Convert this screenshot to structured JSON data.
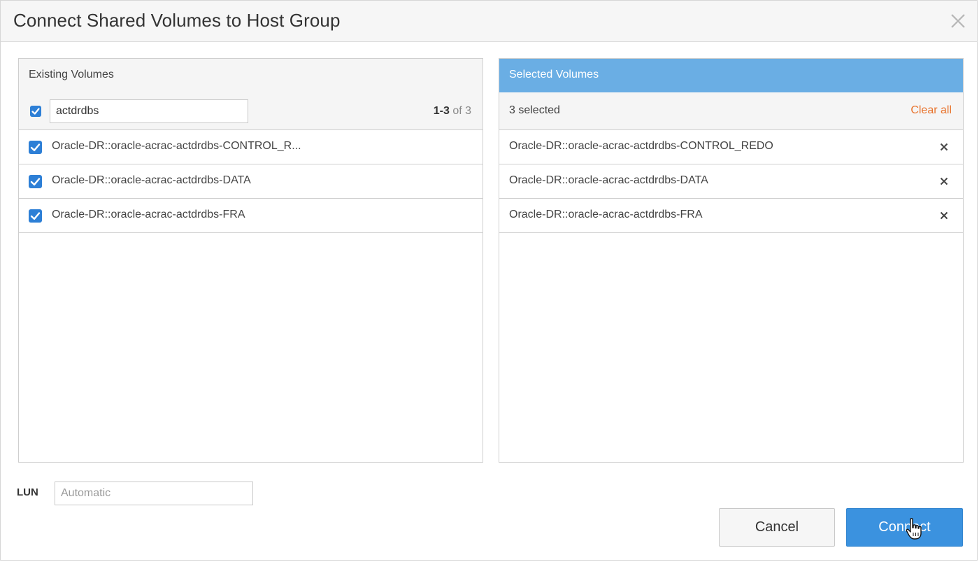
{
  "dialog": {
    "title": "Connect Shared Volumes to Host Group"
  },
  "existing": {
    "title": "Existing Volumes",
    "search_value": "actdrdbs",
    "count_range": "1-3",
    "count_total": "of 3",
    "items": [
      {
        "label": "Oracle-DR::oracle-acrac-actdrdbs-CONTROL_R...",
        "checked": true
      },
      {
        "label": "Oracle-DR::oracle-acrac-actdrdbs-DATA",
        "checked": true
      },
      {
        "label": "Oracle-DR::oracle-acrac-actdrdbs-FRA",
        "checked": true
      }
    ]
  },
  "selected": {
    "title": "Selected Volumes",
    "count_text": "3 selected",
    "clear_all": "Clear all",
    "items": [
      {
        "label": "Oracle-DR::oracle-acrac-actdrdbs-CONTROL_REDO"
      },
      {
        "label": "Oracle-DR::oracle-acrac-actdrdbs-DATA"
      },
      {
        "label": "Oracle-DR::oracle-acrac-actdrdbs-FRA"
      }
    ]
  },
  "lun": {
    "label": "LUN",
    "placeholder": "Automatic"
  },
  "buttons": {
    "cancel": "Cancel",
    "connect": "Connect"
  },
  "colors": {
    "accent": "#3b92df",
    "selected_header": "#6aaee4",
    "clear_all": "#e8742e",
    "checkbox": "#2d7fd6"
  },
  "icons": {
    "close": "close-icon",
    "check": "checkbox-checked-icon",
    "remove": "remove-icon",
    "cursor": "hand-pointer-icon"
  }
}
